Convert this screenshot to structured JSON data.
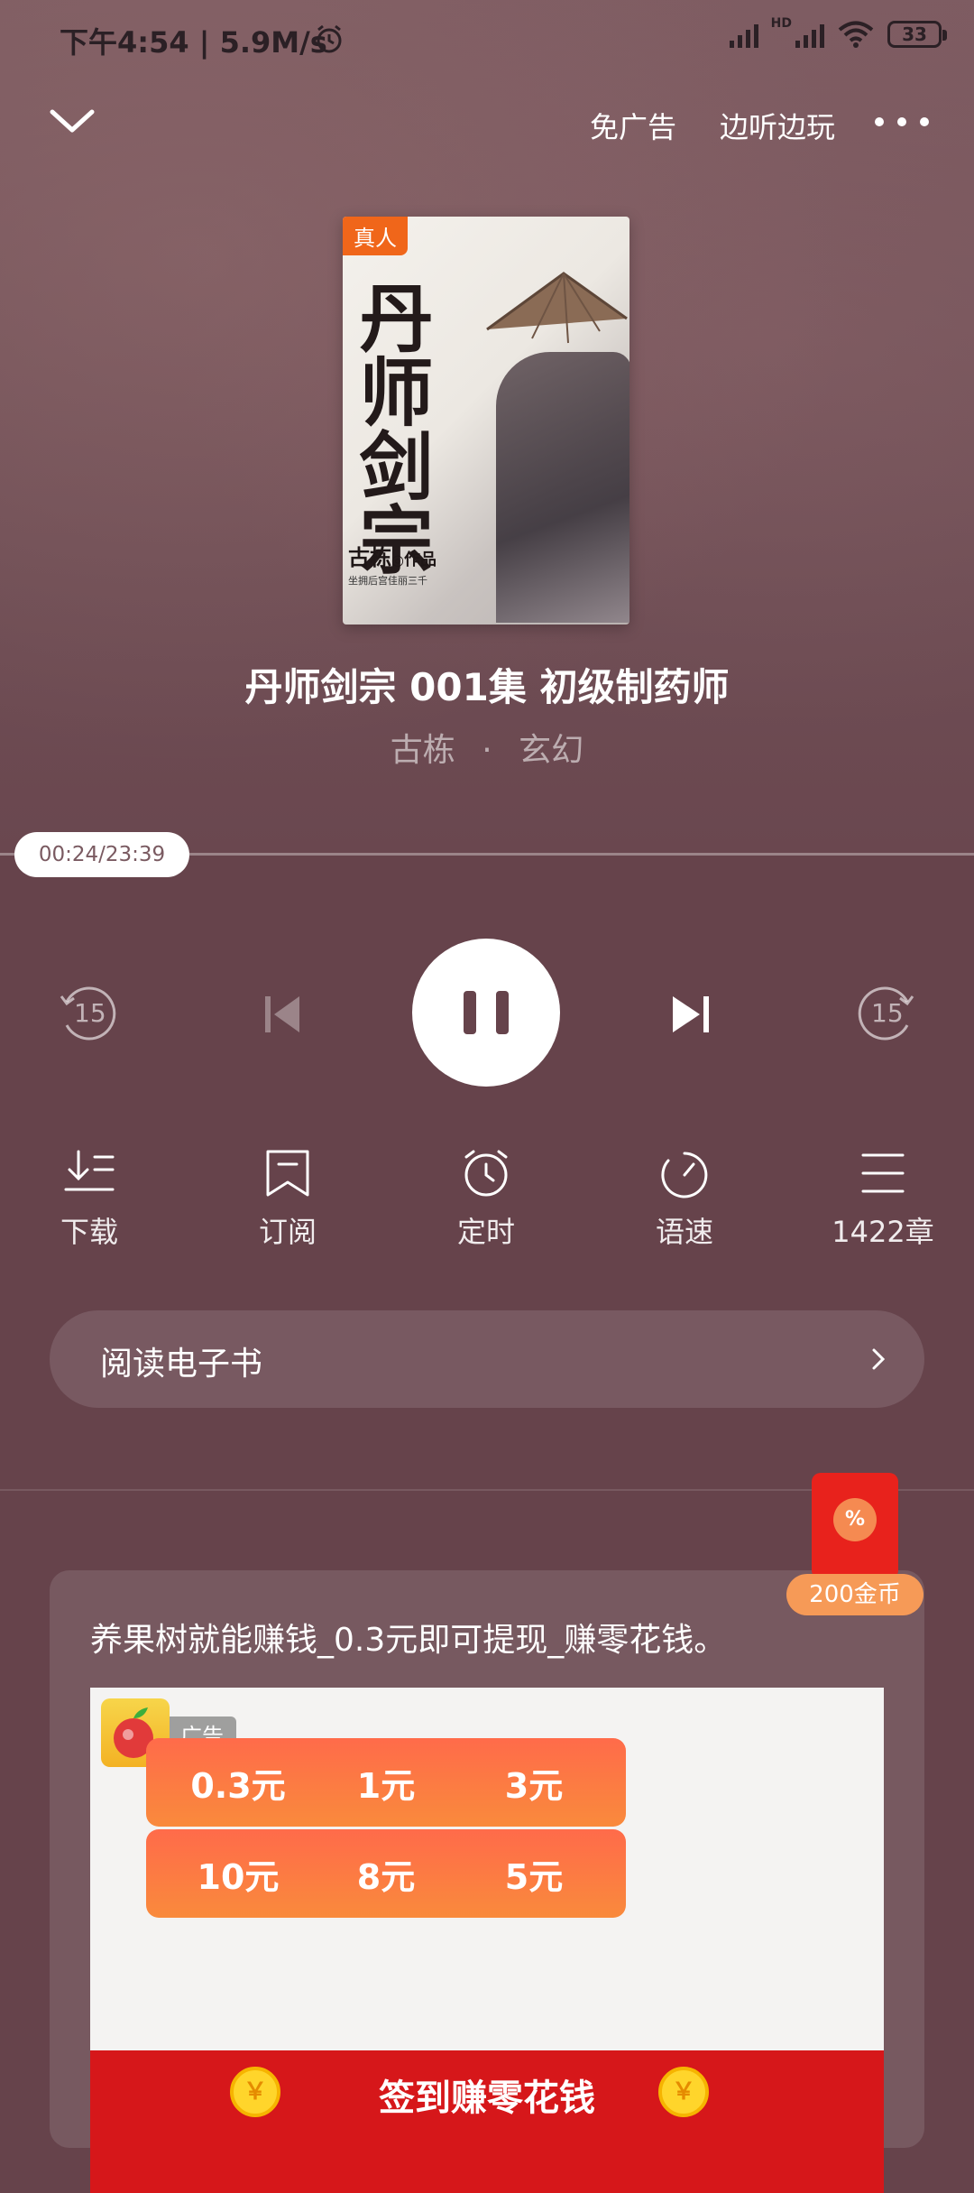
{
  "status_bar": {
    "time": "下午4:54 | 5.9M/s",
    "network_label": "HD",
    "battery": "33"
  },
  "header": {
    "ad_free": "免广告",
    "listen_play": "边听边玩"
  },
  "book": {
    "badge": "真人",
    "cover_title": "丹师剑宗",
    "cover_author": "古栋",
    "cover_author_suffix": "作品",
    "cover_blurb": "坐拥后宫佳丽三千",
    "track_title": "丹师剑宗 001集 初级制药师",
    "author": "古栋",
    "separator": "·",
    "genre": "玄幻"
  },
  "player": {
    "time_display": "00:24/23:39",
    "progress": 0.017,
    "rewind_seconds": "15",
    "forward_seconds": "15"
  },
  "features": [
    {
      "icon": "download-icon",
      "label": "下载"
    },
    {
      "icon": "subscribe-icon",
      "label": "订阅"
    },
    {
      "icon": "timer-icon",
      "label": "定时"
    },
    {
      "icon": "speed-icon",
      "label": "语速"
    },
    {
      "icon": "chapters-icon",
      "label": "1422章"
    }
  ],
  "ebook": {
    "label": "阅读电子书"
  },
  "ad": {
    "title": "养果树就能赚钱_0.3元即可提现_赚零花钱。",
    "tag": "广告",
    "amounts": [
      "0.3元",
      "1元",
      "3元",
      "10元",
      "8元",
      "5元"
    ],
    "cta": "签到赚零花钱",
    "coin_symbol": "￥"
  },
  "reward": {
    "coins": "200金币",
    "seal": "%"
  },
  "colors": {
    "background": "#66434b",
    "accent_orange": "#f0661a",
    "ad_red": "#d6171a"
  }
}
